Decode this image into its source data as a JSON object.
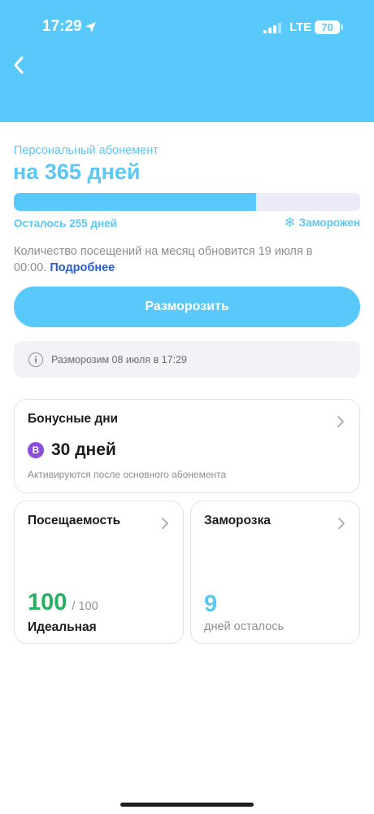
{
  "status_bar": {
    "time": "17:29",
    "network": "LTE",
    "battery": "70"
  },
  "subscription": {
    "type_label": "Персональный абонемент",
    "title": "на 365 дней",
    "progress_fraction": 0.7,
    "remaining": "Осталось 255 дней",
    "frozen_label": "Заморожен",
    "visits_note": "Количество посещений на месяц обновится 19 июля в 00:00.",
    "details_link": "Подробнее"
  },
  "unfreeze_button": "Разморозить",
  "info": {
    "text": "Разморозим 08 июля в 17:29"
  },
  "bonus_card": {
    "title": "Бонусные дни",
    "badge": "B",
    "days": "30 дней",
    "note": "Активируются после основного абонемента"
  },
  "attendance_card": {
    "title": "Посещаемость",
    "value": "100",
    "max": "/ 100",
    "label": "Идеальная"
  },
  "freeze_card": {
    "title": "Заморозка",
    "value": "9",
    "label": "дней осталось"
  },
  "colors": {
    "accent": "#59c8fa",
    "success": "#27ae60",
    "badge": "#8c4dd8",
    "link": "#2a5bd7"
  }
}
